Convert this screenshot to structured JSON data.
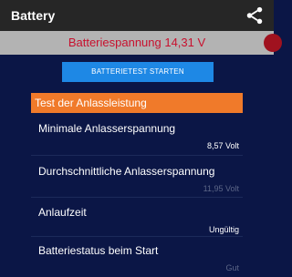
{
  "appbar": {
    "title": "Battery",
    "share_icon": "share-icon"
  },
  "voltage": {
    "text": "Batteriespannung 14,31 V",
    "color": "#c8102e"
  },
  "actions": {
    "start_test_label": "BATTERIETEST STARTEN"
  },
  "section": {
    "title": "Test der Anlassleistung"
  },
  "rows": [
    {
      "label": "Minimale Anlasserspannung",
      "value": "8,57 Volt"
    },
    {
      "label": "Durchschnittliche Anlasserspannung",
      "value": "11,95 Volt"
    },
    {
      "label": "Anlaufzeit",
      "value": "Ungültig"
    },
    {
      "label": "Batteriestatus beim Start",
      "value": "Gut"
    }
  ],
  "colors": {
    "background": "#0b1646",
    "appbar": "#262626",
    "button": "#1e88e5",
    "section_header": "#f07a2a"
  }
}
